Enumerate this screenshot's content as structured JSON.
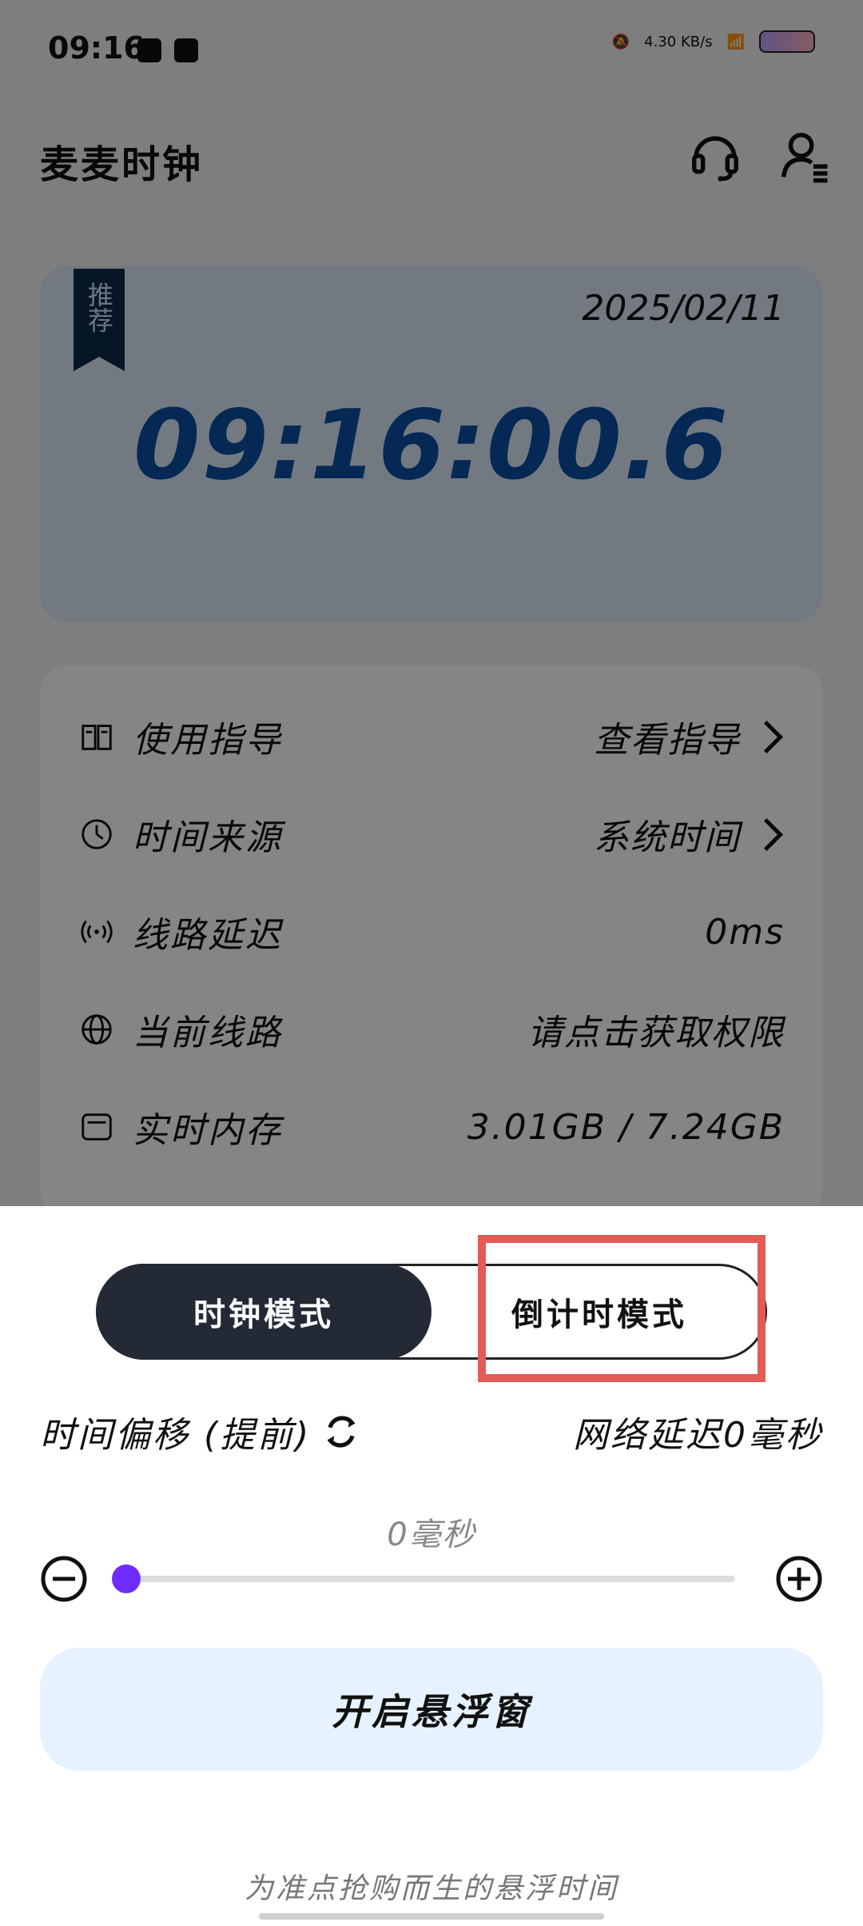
{
  "status_bar": {
    "time": "09:16",
    "net_speed": "4.30 KB/s"
  },
  "app_bar": {
    "title": "麦麦时钟",
    "icons": [
      "headset-icon",
      "user-menu-icon"
    ]
  },
  "clock_card": {
    "tag": "推荐",
    "date": "2025/02/11",
    "time": "09:16:00.6"
  },
  "info": {
    "items": [
      {
        "icon": "book-icon",
        "label": "使用指导",
        "value": "查看指导"
      },
      {
        "icon": "clock-icon",
        "label": "时间来源",
        "value": "系统时间"
      },
      {
        "icon": "signal-icon",
        "label": "线路延迟",
        "value": "0ms"
      },
      {
        "icon": "globe-icon",
        "label": "当前线路",
        "value": "请点击获取权限"
      },
      {
        "icon": "ram-icon",
        "label": "实时内存",
        "value": "3.01GB / 7.24GB"
      }
    ]
  },
  "sheet": {
    "mode_left": "时钟模式",
    "mode_right": "倒计时模式",
    "offset_label": "时间偏移 (提前)",
    "net_delay": "网络延迟0毫秒",
    "slider_value": "0毫秒",
    "slider_fraction": 0.0,
    "cta": "开启悬浮窗",
    "footer": "为准点抢购而生的悬浮时间"
  },
  "colors": {
    "accent": "#6F2CFF",
    "selected_mode_bg": "#232A36",
    "highlight_box": "#E45A55",
    "time_blue": "#0A4EA2",
    "cta_bg": "#E6F2FF"
  }
}
